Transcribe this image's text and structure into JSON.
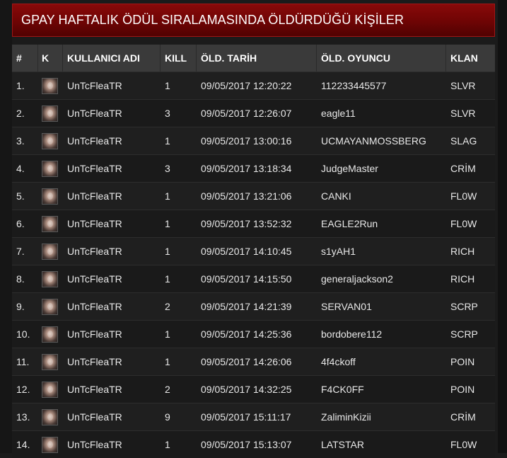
{
  "header": {
    "title": "GPAY HAFTALIK ÖDÜL SIRALAMASINDA ÖLDÜRDÜĞÜ KİŞİLER"
  },
  "table": {
    "columns": [
      "#",
      "K",
      "KULLANICI ADI",
      "KILL",
      "ÖLD. TARİH",
      "ÖLD. OYUNCU",
      "KLAN"
    ],
    "rows": [
      {
        "num": "1.",
        "user": "UnTcFleaTR",
        "kill": "1",
        "date": "09/05/2017 12:20:22",
        "player": "112233445577",
        "clan": "SLVR"
      },
      {
        "num": "2.",
        "user": "UnTcFleaTR",
        "kill": "3",
        "date": "09/05/2017 12:26:07",
        "player": "eagle11",
        "clan": "SLVR"
      },
      {
        "num": "3.",
        "user": "UnTcFleaTR",
        "kill": "1",
        "date": "09/05/2017 13:00:16",
        "player": "UCMAYANMOSSBERG",
        "clan": "SLAG"
      },
      {
        "num": "4.",
        "user": "UnTcFleaTR",
        "kill": "3",
        "date": "09/05/2017 13:18:34",
        "player": "JudgeMaster",
        "clan": "CRİM"
      },
      {
        "num": "5.",
        "user": "UnTcFleaTR",
        "kill": "1",
        "date": "09/05/2017 13:21:06",
        "player": "CANKI",
        "clan": "FL0W"
      },
      {
        "num": "6.",
        "user": "UnTcFleaTR",
        "kill": "1",
        "date": "09/05/2017 13:52:32",
        "player": "EAGLE2Run",
        "clan": "FL0W"
      },
      {
        "num": "7.",
        "user": "UnTcFleaTR",
        "kill": "1",
        "date": "09/05/2017 14:10:45",
        "player": "s1yAH1",
        "clan": "RICH"
      },
      {
        "num": "8.",
        "user": "UnTcFleaTR",
        "kill": "1",
        "date": "09/05/2017 14:15:50",
        "player": "generaljackson2",
        "clan": "RICH"
      },
      {
        "num": "9.",
        "user": "UnTcFleaTR",
        "kill": "2",
        "date": "09/05/2017 14:21:39",
        "player": "SERVAN01",
        "clan": "SCRP"
      },
      {
        "num": "10.",
        "user": "UnTcFleaTR",
        "kill": "1",
        "date": "09/05/2017 14:25:36",
        "player": "bordobere112",
        "clan": "SCRP"
      },
      {
        "num": "11.",
        "user": "UnTcFleaTR",
        "kill": "1",
        "date": "09/05/2017 14:26:06",
        "player": "4f4ckoff",
        "clan": "POIN"
      },
      {
        "num": "12.",
        "user": "UnTcFleaTR",
        "kill": "2",
        "date": "09/05/2017 14:32:25",
        "player": "F4CK0FF",
        "clan": "POIN"
      },
      {
        "num": "13.",
        "user": "UnTcFleaTR",
        "kill": "9",
        "date": "09/05/2017 15:11:17",
        "player": "ZaliminKizii",
        "clan": "CRİM"
      },
      {
        "num": "14.",
        "user": "UnTcFleaTR",
        "kill": "1",
        "date": "09/05/2017 15:13:07",
        "player": "LATSTAR",
        "clan": "FL0W"
      }
    ]
  },
  "icons": {
    "avatar": "player-avatar-icon"
  },
  "colors": {
    "header_red": "#7a0606",
    "header_row": "#3a3a3a",
    "row_bg": "#1f1f1f"
  }
}
